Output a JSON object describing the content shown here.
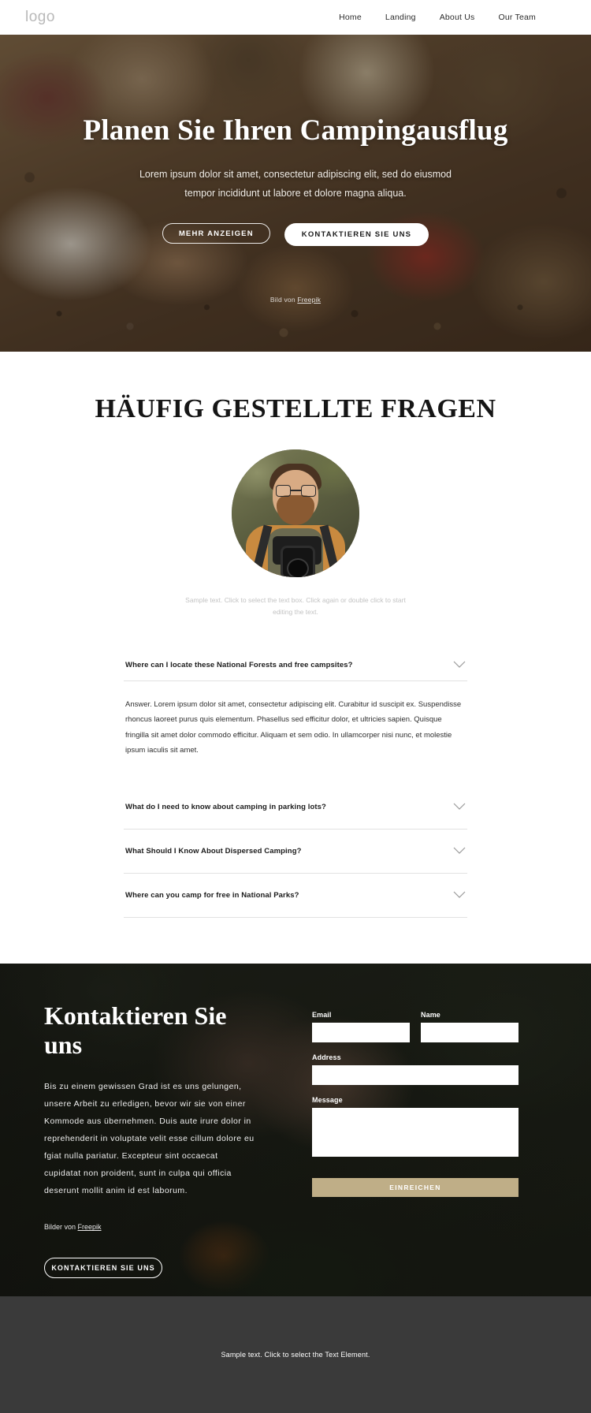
{
  "header": {
    "logo": "logo",
    "nav": [
      {
        "label": "Home"
      },
      {
        "label": "Landing"
      },
      {
        "label": "About Us"
      },
      {
        "label": "Our Team"
      }
    ]
  },
  "hero": {
    "title": "Planen Sie Ihren Campingausflug",
    "subtitle": "Lorem ipsum dolor sit amet, consectetur adipiscing elit, sed do eiusmod tempor incididunt ut labore et dolore magna aliqua.",
    "primary_button": "MEHR ANZEIGEN",
    "secondary_button": "KONTAKTIEREN SIE UNS",
    "credit_prefix": "Bild von ",
    "credit_link": "Freepik"
  },
  "faq": {
    "title": "HÄUFIG GESTELLTE FRAGEN",
    "avatar_caption": "Sample text. Click to select the text box. Click again or double click to start editing the text.",
    "chevron_icon": "chevron-down-icon",
    "items": [
      {
        "question": "Where can I locate these National Forests and free campsites?",
        "answer": "Answer. Lorem ipsum dolor sit amet, consectetur adipiscing elit. Curabitur id suscipit ex. Suspendisse rhoncus laoreet purus quis elementum. Phasellus sed efficitur dolor, et ultricies sapien. Quisque fringilla sit amet dolor commodo efficitur. Aliquam et sem odio. In ullamcorper nisi nunc, et molestie ipsum iaculis sit amet.",
        "expanded": true
      },
      {
        "question": "What do I need to know about camping in parking lots?",
        "answer": "",
        "expanded": false
      },
      {
        "question": "What Should I Know About Dispersed Camping?",
        "answer": "",
        "expanded": false
      },
      {
        "question": "Where can you camp for free in National Parks?",
        "answer": "",
        "expanded": false
      }
    ]
  },
  "contact": {
    "title": "Kontaktieren Sie uns",
    "body": "Bis zu einem gewissen Grad ist es uns gelungen, unsere Arbeit zu erledigen, bevor wir sie von einer Kommode aus übernehmen. Duis aute irure dolor in reprehenderit in voluptate velit esse cillum dolore eu fgiat nulla pariatur. Excepteur sint occaecat cupidatat non proident, sunt in culpa qui officia deserunt mollit anim id est laborum.",
    "credit_prefix": "Bilder von ",
    "credit_link": "Freepik",
    "button": "KONTAKTIEREN SIE UNS",
    "form": {
      "email_label": "Email",
      "email_value": "",
      "name_label": "Name",
      "name_value": "",
      "address_label": "Address",
      "address_value": "",
      "message_label": "Message",
      "message_value": "",
      "submit_label": "EINREICHEN",
      "submit_color": "#bfae87"
    }
  },
  "footer": {
    "text": "Sample text. Click to select the Text Element.",
    "background": "#3a3a3a"
  }
}
